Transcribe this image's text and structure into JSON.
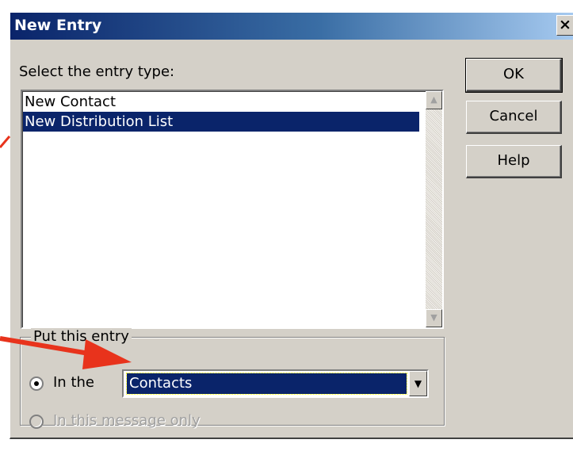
{
  "window": {
    "title": "New Entry",
    "close_glyph": "×"
  },
  "entry_type": {
    "label": "Select the entry type:",
    "items": [
      {
        "label": "New Contact",
        "selected": false
      },
      {
        "label": "New Distribution List",
        "selected": true
      }
    ]
  },
  "buttons": {
    "ok": "OK",
    "cancel": "Cancel",
    "help": "Help"
  },
  "placement": {
    "group_label": "Put this entry",
    "option_folder_label": "In the",
    "option_folder_checked": true,
    "folder_value": "Contacts",
    "option_message_label": "In this message only",
    "option_message_enabled": false
  },
  "annotation": {
    "arrow_color": "#e8331c"
  },
  "colors": {
    "dialog_bg": "#d4d0c8",
    "selection": "#0a246a",
    "title_gradient_start": "#0a246a",
    "title_gradient_end": "#a6caf0"
  }
}
